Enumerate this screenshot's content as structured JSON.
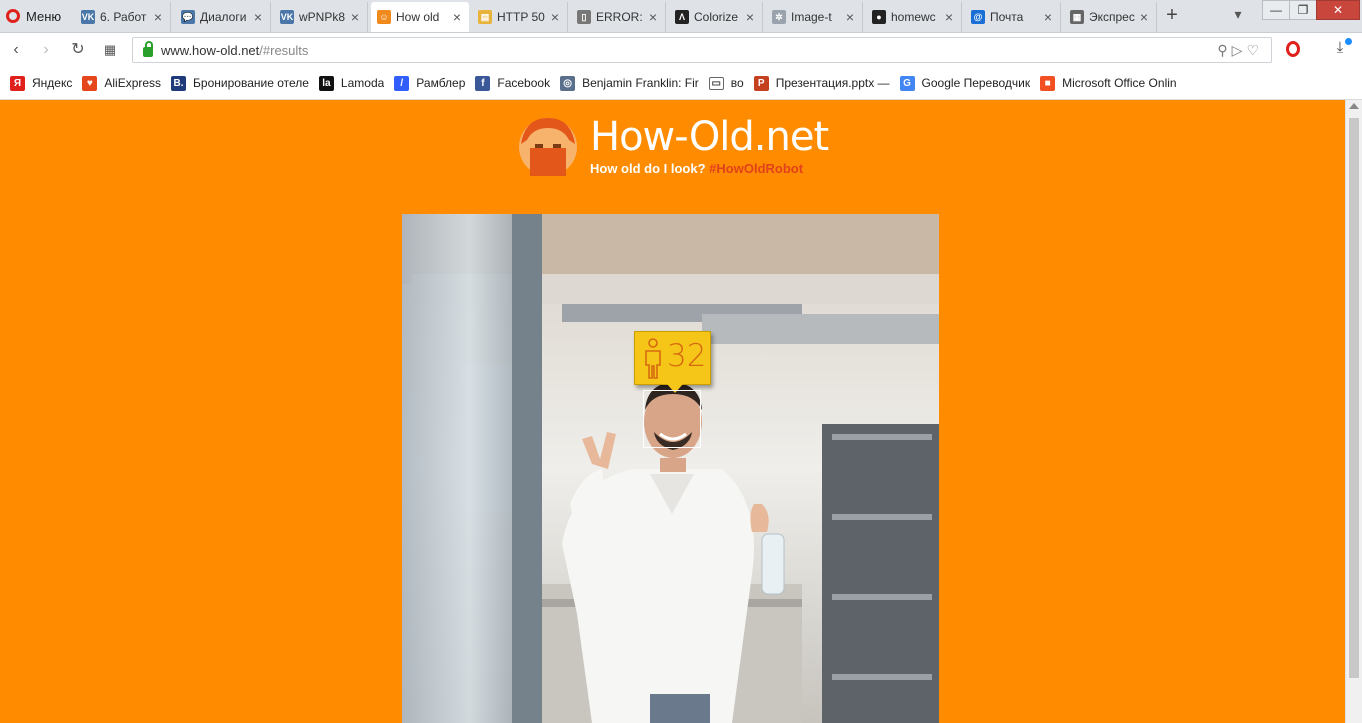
{
  "browser": {
    "menu_label": "Меню",
    "tabs": [
      {
        "title": "6. Работ",
        "icon": "vk-icon",
        "color": "#4a76a8",
        "glyph": "VK"
      },
      {
        "title": "Диалоги",
        "icon": "vk-dialog-icon",
        "color": "#4a76a8",
        "glyph": "💬"
      },
      {
        "title": "wPNPk8",
        "icon": "vk-icon",
        "color": "#4a76a8",
        "glyph": "VK"
      },
      {
        "title": "How old",
        "icon": "how-old-icon",
        "color": "#f08a1c",
        "glyph": "☺",
        "active": true
      },
      {
        "title": "HTTP 50",
        "icon": "folder-icon",
        "color": "#e8b33a",
        "glyph": "▤"
      },
      {
        "title": "ERROR:",
        "icon": "page-icon",
        "color": "#777777",
        "glyph": "▯"
      },
      {
        "title": "Colorize",
        "icon": "colorize-icon",
        "color": "#222222",
        "glyph": "Λ"
      },
      {
        "title": "Image-t",
        "icon": "gear-icon",
        "color": "#9aa3ad",
        "glyph": "✲"
      },
      {
        "title": "homewc",
        "icon": "github-icon",
        "color": "#222222",
        "glyph": "●"
      },
      {
        "title": "Почта",
        "icon": "mail-icon",
        "color": "#1a6fd6",
        "glyph": "@"
      },
      {
        "title": "Экспрес",
        "icon": "speed-dial-icon",
        "color": "#666666",
        "glyph": "▦"
      }
    ],
    "new_tab_label": "+",
    "address": {
      "host": "www.how-old.net",
      "path": "/#results"
    },
    "bookmarks": [
      {
        "label": "Яндекс",
        "icon": "yandex-icon",
        "color": "#e0201a",
        "glyph": "Я"
      },
      {
        "label": "AliExpress",
        "icon": "aliexpress-icon",
        "color": "#e6461c",
        "glyph": "♥"
      },
      {
        "label": "Бронирование отеле",
        "icon": "booking-icon",
        "color": "#1f3b7a",
        "glyph": "B."
      },
      {
        "label": "Lamoda",
        "icon": "lamoda-icon",
        "color": "#111111",
        "glyph": "la"
      },
      {
        "label": "Рамблер",
        "icon": "rambler-icon",
        "color": "#315efb",
        "glyph": "/"
      },
      {
        "label": "Facebook",
        "icon": "facebook-icon",
        "color": "#3b5998",
        "glyph": "f"
      },
      {
        "label": "Benjamin Franklin: Fir",
        "icon": "seal-icon",
        "color": "#5a6f8c",
        "glyph": "◎"
      },
      {
        "label": "во",
        "icon": "folder-icon",
        "color": "#ffffff",
        "glyph": "▭"
      },
      {
        "label": "Презентация.pptx —",
        "icon": "powerpoint-icon",
        "color": "#c4401f",
        "glyph": "P"
      },
      {
        "label": "Google Переводчик",
        "icon": "google-translate-icon",
        "color": "#4285f4",
        "glyph": "G"
      },
      {
        "label": "Microsoft Office Onlin",
        "icon": "microsoft-office-icon",
        "color": "#f25022",
        "glyph": "■"
      }
    ]
  },
  "site": {
    "title": "How-Old.net",
    "tagline": "How old do I look?",
    "hashtag": "#HowOldRobot",
    "age_result": "32",
    "colors": {
      "background": "#ff8c00",
      "badge": "#f5c518",
      "hashtag": "#e2411c"
    }
  }
}
